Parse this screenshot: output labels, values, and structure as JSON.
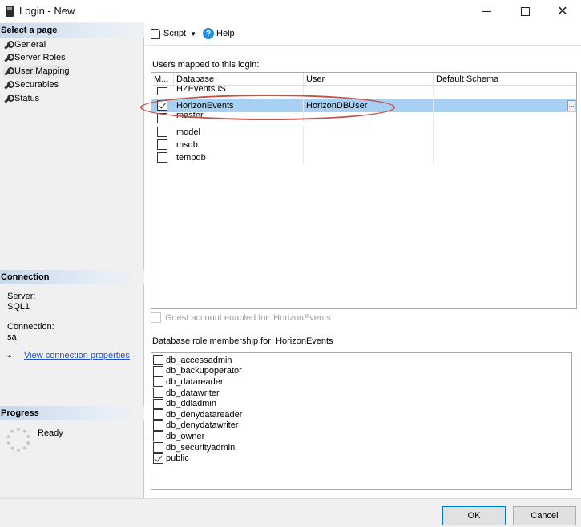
{
  "window": {
    "title": "Login - New",
    "minimize": "—",
    "close": "✕"
  },
  "left": {
    "select_page_header": "Select a page",
    "pages": [
      {
        "label": "General"
      },
      {
        "label": "Server Roles"
      },
      {
        "label": "User Mapping"
      },
      {
        "label": "Securables"
      },
      {
        "label": "Status"
      }
    ],
    "connection_header": "Connection",
    "server_label": "Server:",
    "server_value": "SQL1",
    "connection_label": "Connection:",
    "connection_value": "sa",
    "view_props_link": "View connection properties",
    "progress_header": "Progress",
    "progress_status": "Ready"
  },
  "toolbar": {
    "script_label": "Script",
    "help_label": "Help"
  },
  "mapping": {
    "section_label": "Users mapped to this login:",
    "columns": [
      "M...",
      "Database",
      "User",
      "Default Schema"
    ],
    "rows": [
      {
        "database": "HZEvents.IS",
        "user": "",
        "schema": "",
        "checked": false,
        "selected": false
      },
      {
        "database": "HorizonEvents",
        "user": "HorizonDBUser",
        "schema": "",
        "checked": true,
        "selected": true
      },
      {
        "database": "master",
        "user": "",
        "schema": "",
        "checked": false,
        "selected": false
      },
      {
        "database": "model",
        "user": "",
        "schema": "",
        "checked": false,
        "selected": false
      },
      {
        "database": "msdb",
        "user": "",
        "schema": "",
        "checked": false,
        "selected": false
      },
      {
        "database": "tempdb",
        "user": "",
        "schema": "",
        "checked": false,
        "selected": false
      }
    ],
    "ellipsis": "..."
  },
  "guest": {
    "label": "Guest account enabled for: HorizonEvents"
  },
  "roles": {
    "section_label": "Database role membership for: HorizonEvents",
    "items": [
      {
        "label": "db_accessadmin",
        "checked": false
      },
      {
        "label": "db_backupoperator",
        "checked": false
      },
      {
        "label": "db_datareader",
        "checked": false
      },
      {
        "label": "db_datawriter",
        "checked": false
      },
      {
        "label": "db_ddladmin",
        "checked": false
      },
      {
        "label": "db_denydatareader",
        "checked": false
      },
      {
        "label": "db_denydatawriter",
        "checked": false
      },
      {
        "label": "db_owner",
        "checked": false
      },
      {
        "label": "db_securityadmin",
        "checked": false
      },
      {
        "label": "public",
        "checked": true
      }
    ]
  },
  "buttons": {
    "ok": "OK",
    "cancel": "Cancel"
  },
  "colors": {
    "selection": "#a8d0f2",
    "highlight_oval": "#c0524a",
    "link": "#1a4fd6",
    "help_icon": "#1f8fe6"
  }
}
